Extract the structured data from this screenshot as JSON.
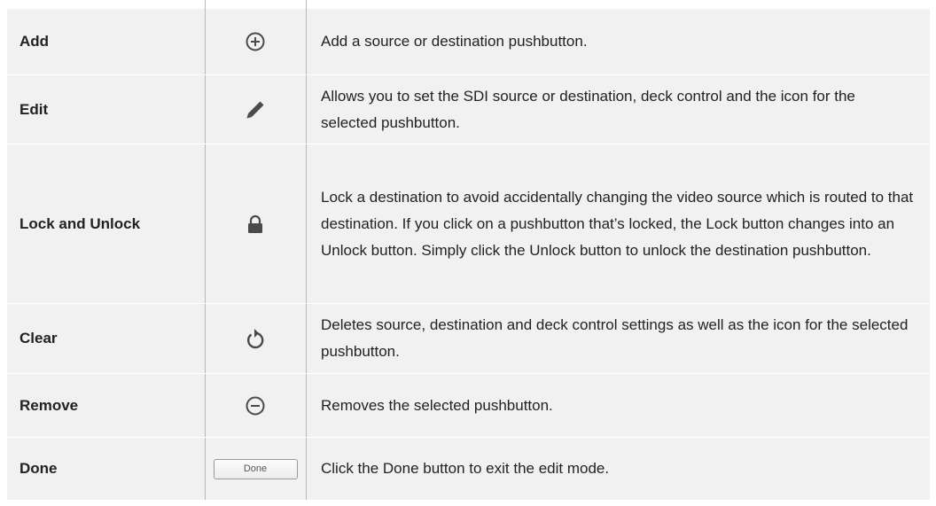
{
  "rows": [
    {
      "name": "Add",
      "icon": "plus-circle-icon",
      "description": "Add a source or destination pushbutton."
    },
    {
      "name": "Edit",
      "icon": "pencil-icon",
      "description": "Allows you to set the SDI source or destination, deck control and the icon for the selected pushbutton."
    },
    {
      "name": "Lock and Unlock",
      "icon": "lock-icon",
      "description": "Lock a destination to avoid accidentally changing the video source which is routed to that destination. If you click on a pushbutton that’s locked, the Lock button changes into an Unlock button. Simply click the Unlock button to unlock the destination pushbutton."
    },
    {
      "name": "Clear",
      "icon": "reset-arrow-icon",
      "description": "Deletes source, destination and deck control settings as well as the icon for the selected pushbutton."
    },
    {
      "name": "Remove",
      "icon": "minus-circle-icon",
      "description": "Removes the selected pushbutton."
    },
    {
      "name": "Done",
      "icon": "done-button",
      "button_label": "Done",
      "description": "Click the Done button to exit the edit mode."
    }
  ],
  "colors": {
    "background": "#f1f1f1",
    "divider": "#b8b8b8",
    "icon": "#4a4a4a",
    "text": "#222222"
  }
}
